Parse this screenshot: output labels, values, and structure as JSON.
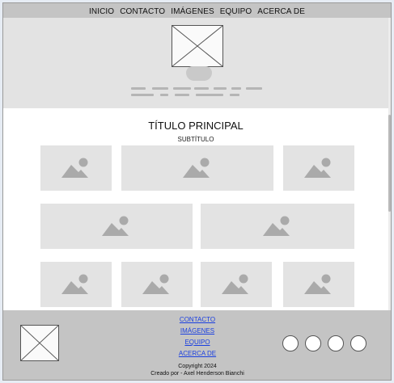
{
  "nav": {
    "items": [
      "INICIO",
      "CONTACTO",
      "IMÁGENES",
      "EQUIPO",
      "ACERCA DE"
    ]
  },
  "hero": {
    "image": "image-placeholder-icon"
  },
  "main": {
    "title": "TÍTULO PRINCIPAL",
    "subtitle": "SUBTÍTULO",
    "gallery_icon": "image-icon"
  },
  "footer": {
    "links": [
      "CONTACTO",
      "IMÁGENES",
      "EQUIPO",
      "ACERCA DE"
    ],
    "copyright": "Copyright 2024",
    "credit": "Creado por - Axel Henderson Bianchi",
    "social_icons": [
      "social-icon-1",
      "social-icon-2",
      "social-icon-3",
      "social-icon-4"
    ]
  },
  "colors": {
    "bar": "#c4c4c4",
    "placeholder": "#e3e3e3",
    "link": "#1a3fe0"
  }
}
